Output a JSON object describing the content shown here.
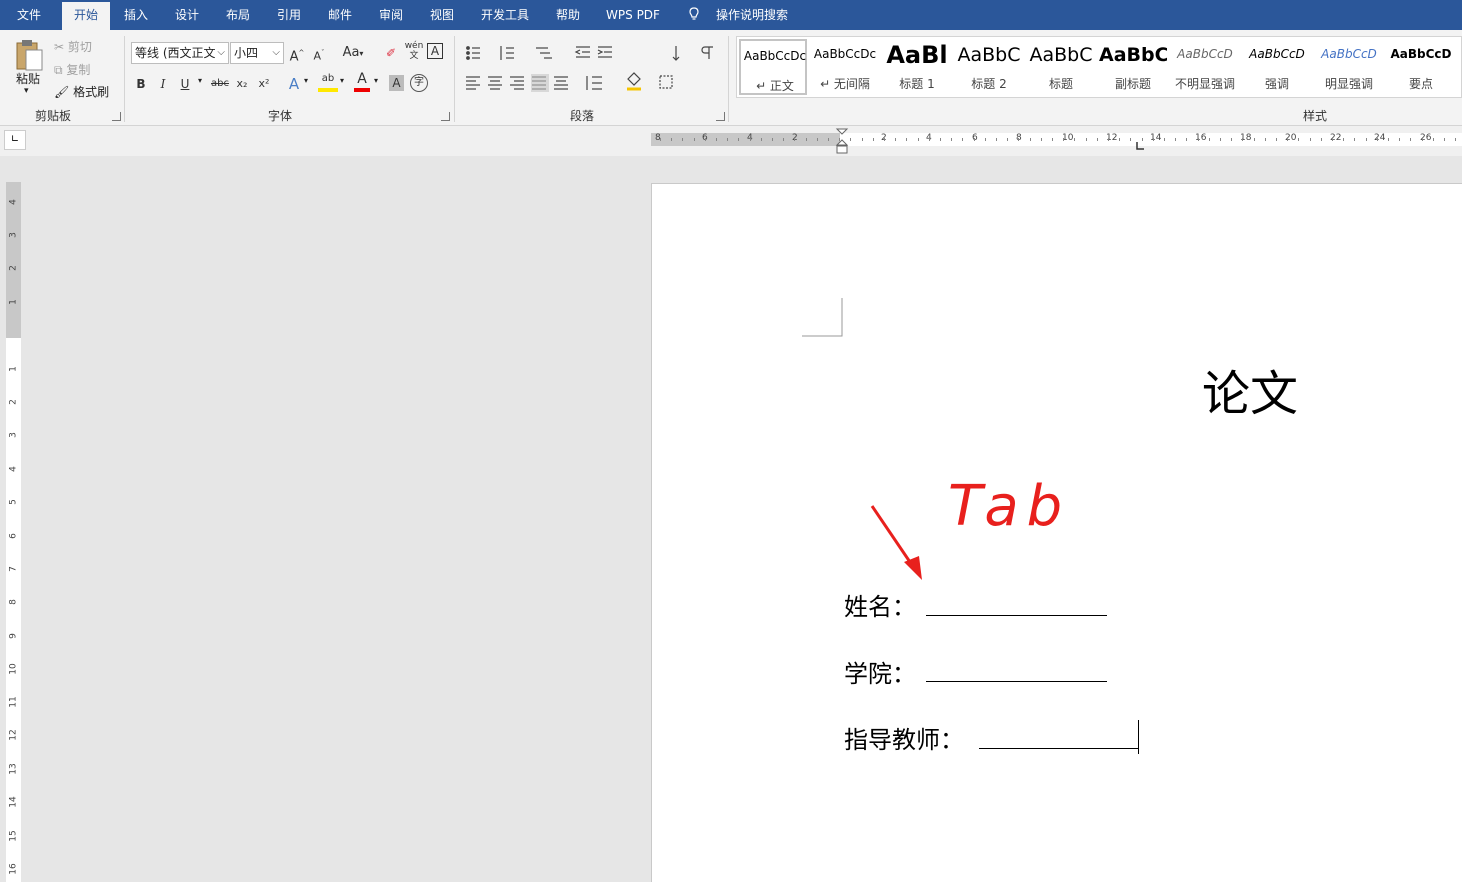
{
  "menu": {
    "items": [
      "文件",
      "开始",
      "插入",
      "设计",
      "布局",
      "引用",
      "邮件",
      "审阅",
      "视图",
      "开发工具",
      "帮助",
      "WPS PDF"
    ],
    "search_label": "操作说明搜索",
    "active": "开始"
  },
  "clipboard": {
    "paste_label": "粘贴",
    "cut_label": "剪切",
    "copy_label": "复制",
    "format_painter_label": "格式刷",
    "group_label": "剪贴板"
  },
  "font": {
    "font_name": "等线 (西文正文",
    "font_size": "小四",
    "group_label": "字体",
    "bold": "B",
    "italic": "I",
    "underline": "U",
    "strike": "abc",
    "subscript": "x₂",
    "superscript": "x²",
    "grow": "A",
    "shrink": "A",
    "case": "Aa",
    "phonetic": "wén",
    "border_char": "A",
    "effects": "A",
    "highlight": "ab",
    "font_color": "A",
    "shading": "A",
    "enclose": "字"
  },
  "paragraph": {
    "group_label": "段落"
  },
  "styles": {
    "group_label": "样式",
    "items": [
      {
        "sample": "AaBbCcDc",
        "name": "↵ 正文"
      },
      {
        "sample": "AaBbCcDc",
        "name": "↵ 无间隔"
      },
      {
        "sample": "AaBl",
        "name": "标题 1"
      },
      {
        "sample": "AaBbC",
        "name": "标题 2"
      },
      {
        "sample": "AaBbC",
        "name": "标题"
      },
      {
        "sample": "AaBbC",
        "name": "副标题"
      },
      {
        "sample": "AaBbCcD",
        "name": "不明显强调"
      },
      {
        "sample": "AaBbCcD",
        "name": "强调"
      },
      {
        "sample": "AaBbCcD",
        "name": "明显强调"
      },
      {
        "sample": "AaBbCcD",
        "name": "要点"
      }
    ]
  },
  "ruler": {
    "h_labels": [
      "8",
      "6",
      "4",
      "2",
      "2",
      "4",
      "6",
      "8",
      "10",
      "12",
      "14",
      "16",
      "18",
      "20",
      "22",
      "24",
      "26"
    ],
    "v_labels": [
      "4",
      "3",
      "2",
      "1",
      "1",
      "1",
      "2",
      "3",
      "4",
      "5",
      "6",
      "7",
      "8",
      "9",
      "10",
      "11",
      "12",
      "13",
      "14",
      "15",
      "16"
    ]
  },
  "document": {
    "title": "论文",
    "annotation": "Tab",
    "fields": [
      {
        "label": "姓名："
      },
      {
        "label": "学院："
      },
      {
        "label": "指导教师："
      }
    ]
  },
  "colors": {
    "menu_bg": "#2b579a",
    "annotation": "#e8201d"
  }
}
